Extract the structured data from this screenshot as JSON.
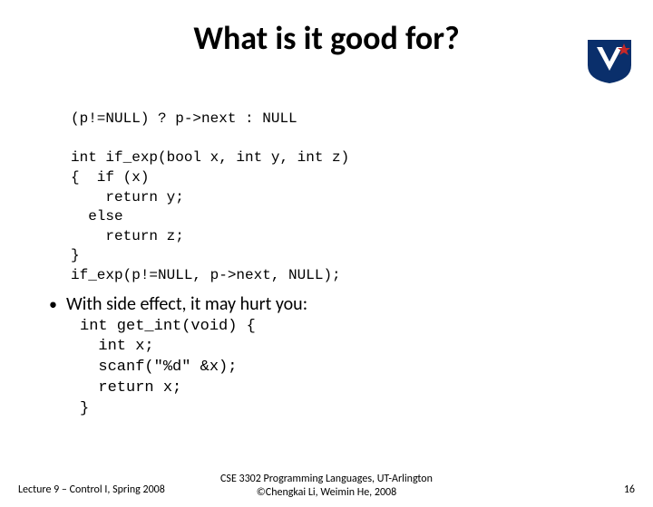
{
  "title": "What is it good for?",
  "code1": "(p!=NULL) ? p->next : NULL",
  "code2": "int if_exp(bool x, int y, int z)\n{  if (x)\n    return y;\n  else\n    return z;\n}\nif_exp(p!=NULL, p->next, NULL);",
  "bullet": "With side effect, it may hurt you:",
  "code3": "int get_int(void) {\n  int x;\n  scanf(\"%d\" &x);\n  return x;\n}",
  "footer": {
    "left": "Lecture 9 – Control I, Spring 2008",
    "center_line1": "CSE 3302 Programming Languages, UT-Arlington",
    "center_line2": "©Chengkai Li, Weimin He, 2008",
    "right": "16"
  },
  "logo_alt": "UTA shield logo"
}
